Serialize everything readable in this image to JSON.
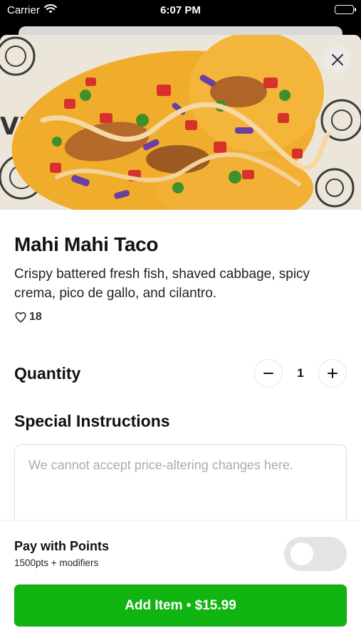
{
  "status_bar": {
    "carrier": "Carrier",
    "time": "6:07 PM"
  },
  "hero": {
    "image": "mahi-mahi-taco-photo",
    "close_icon": "close-icon"
  },
  "item": {
    "title": "Mahi Mahi Taco",
    "description": "Crispy battered fresh fish, shaved cabbage, spicy crema, pico de gallo, and cilantro.",
    "likes": "18",
    "like_icon": "heart-outline-icon"
  },
  "quantity": {
    "label": "Quantity",
    "value": "1",
    "decrement_icon": "minus-icon",
    "increment_icon": "plus-icon"
  },
  "special_instructions": {
    "label": "Special Instructions",
    "placeholder": "We cannot accept price-altering changes here."
  },
  "points": {
    "title": "Pay with Points",
    "subtitle": "1500pts + modifiers",
    "toggle_on": false
  },
  "add_button": {
    "label": "Add Item • $15.99"
  },
  "colors": {
    "accent": "#11b512",
    "toggle_off": "#e4e4e4"
  }
}
